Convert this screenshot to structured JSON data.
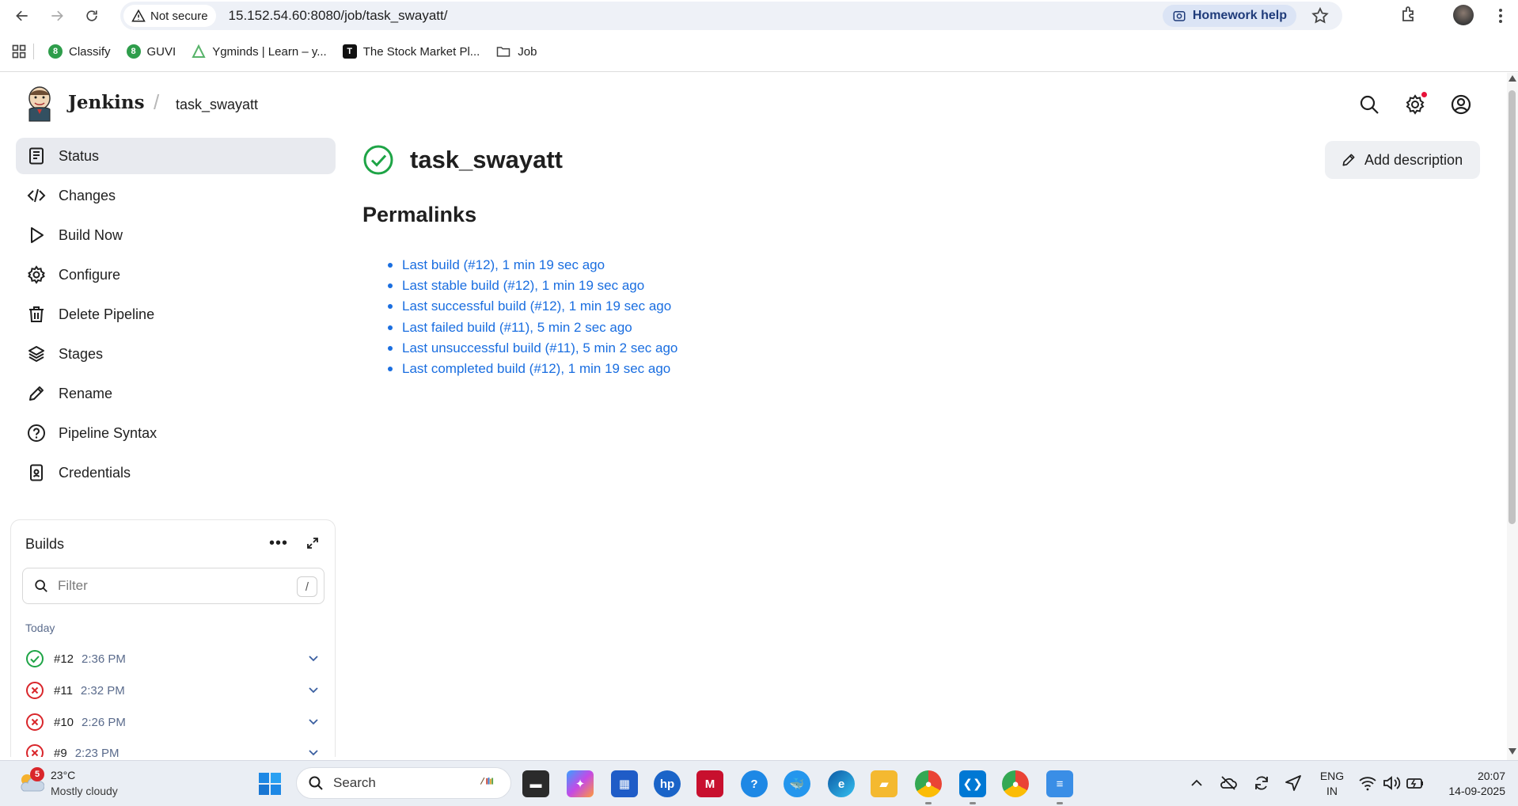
{
  "browser": {
    "security_label": "Not secure",
    "url": "15.152.54.60:8080/job/task_swayatt/",
    "homework_label": "Homework help"
  },
  "bookmarks": [
    {
      "label": "Classify",
      "icon": "classify-icon",
      "color": "#2e9d4b"
    },
    {
      "label": "GUVI",
      "icon": "guvi-icon",
      "color": "#2e9d4b"
    },
    {
      "label": "Ygminds | Learn – y...",
      "icon": "ygminds-icon",
      "color": "#58b36a"
    },
    {
      "label": "The Stock Market Pl...",
      "icon": "stock-market-icon",
      "color": "#111111"
    },
    {
      "label": "Job",
      "icon": "folder-icon",
      "color": "#444444"
    }
  ],
  "header": {
    "app_title": "Jenkins",
    "breadcrumb_job": "task_swayatt"
  },
  "sidebar": {
    "items": [
      {
        "label": "Status",
        "icon": "status-doc-icon",
        "active": true
      },
      {
        "label": "Changes",
        "icon": "code-icon",
        "active": false
      },
      {
        "label": "Build Now",
        "icon": "play-icon",
        "active": false
      },
      {
        "label": "Configure",
        "icon": "gear-icon",
        "active": false
      },
      {
        "label": "Delete Pipeline",
        "icon": "trash-icon",
        "active": false
      },
      {
        "label": "Stages",
        "icon": "layers-icon",
        "active": false
      },
      {
        "label": "Rename",
        "icon": "pencil-icon",
        "active": false
      },
      {
        "label": "Pipeline Syntax",
        "icon": "help-circle-icon",
        "active": false
      },
      {
        "label": "Credentials",
        "icon": "credentials-icon",
        "active": false
      }
    ]
  },
  "builds": {
    "title": "Builds",
    "more_label": "•••",
    "filter_placeholder": "Filter",
    "filter_shortcut": "/",
    "group_label": "Today",
    "rows": [
      {
        "number": "#12",
        "time": "2:36 PM",
        "status": "success"
      },
      {
        "number": "#11",
        "time": "2:32 PM",
        "status": "failed"
      },
      {
        "number": "#10",
        "time": "2:26 PM",
        "status": "failed"
      },
      {
        "number": "#9",
        "time": "2:23 PM",
        "status": "failed"
      }
    ]
  },
  "main": {
    "job_title": "task_swayatt",
    "add_description_label": "Add description",
    "permalinks_title": "Permalinks",
    "permalinks": [
      "Last build (#12), 1 min 19 sec ago",
      "Last stable build (#12), 1 min 19 sec ago",
      "Last successful build (#12), 1 min 19 sec ago",
      "Last failed build (#11), 5 min 2 sec ago",
      "Last unsuccessful build (#11), 5 min 2 sec ago",
      "Last completed build (#12), 1 min 19 sec ago"
    ]
  },
  "taskbar": {
    "weather_badge": "5",
    "weather_temp": "23°C",
    "weather_desc": "Mostly cloudy",
    "search_label": "Search",
    "lang_line1": "ENG",
    "lang_line2": "IN",
    "time": "20:07",
    "date": "14-09-2025"
  },
  "colors": {
    "success": "#1ea446",
    "failed": "#d9262b",
    "link": "#1a6ee0",
    "active_bg": "#e8eaef"
  }
}
